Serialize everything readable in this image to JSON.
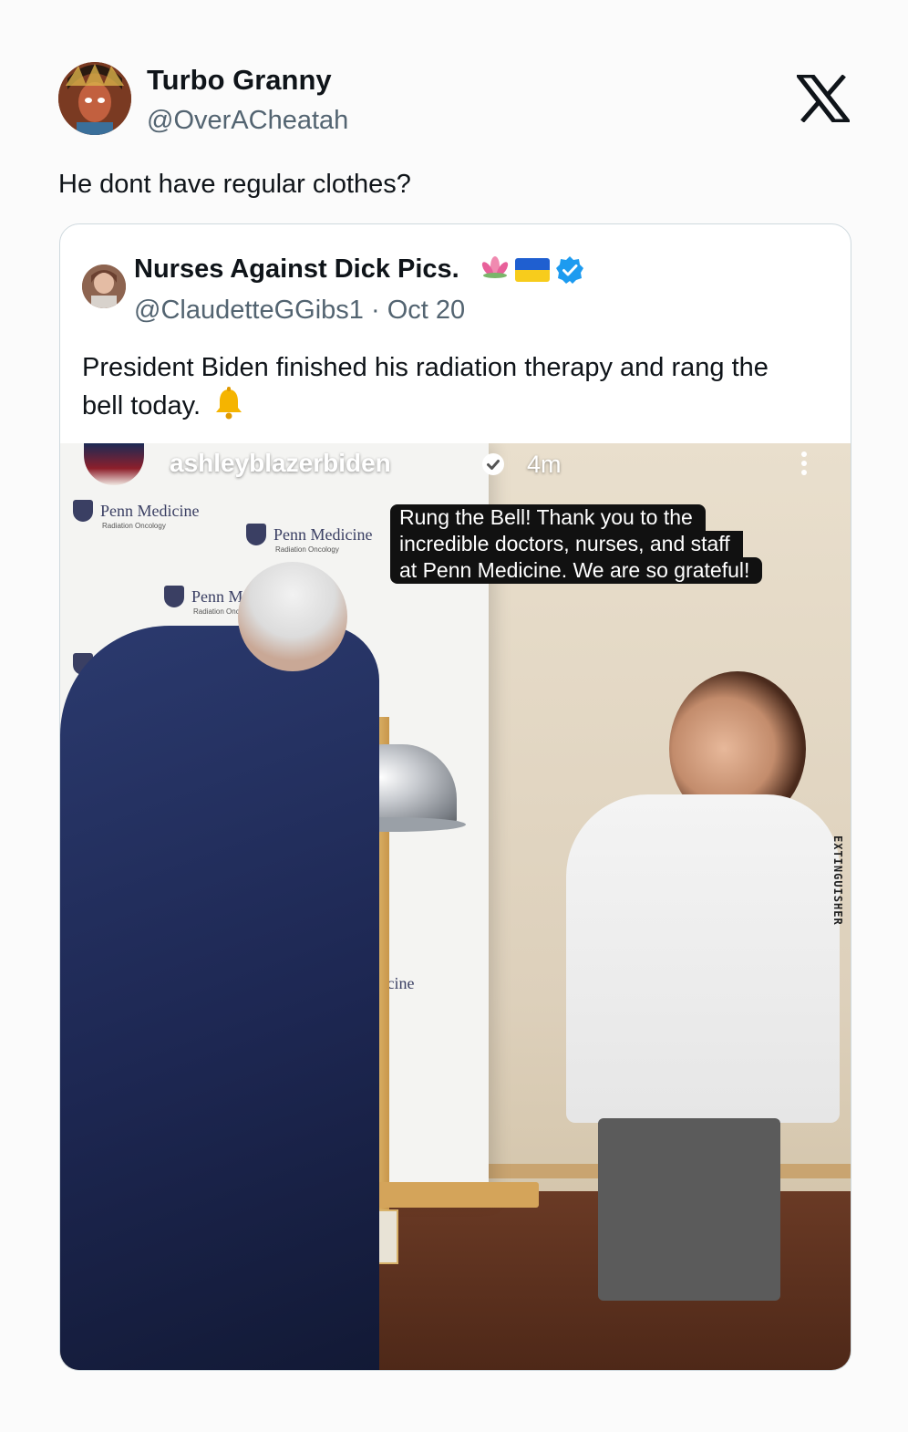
{
  "tweet": {
    "author_name": "Turbo Granny",
    "author_handle": "@OverACheatah",
    "text": "He dont have regular clothes?",
    "platform_icon": "x-logo-icon"
  },
  "quoted": {
    "author_name": "Nurses Against Dick Pics.",
    "author_handle": "@ClaudetteGGibs1",
    "separator": "·",
    "date": "Oct 20",
    "emojis": [
      "lotus-icon",
      "ukraine-flag-icon",
      "verified-badge-icon"
    ],
    "text": "President Biden finished his radiation therapy and rang the bell today.",
    "trailing_emoji": "bell-icon"
  },
  "story": {
    "username": "ashleyblazerbiden",
    "time": "4m",
    "caption_lines": [
      "Rung the Bell! Thank you to the",
      "incredible doctors, nurses, and staff",
      "at Penn Medicine. We are so grateful!"
    ],
    "backdrop_logo": {
      "title": "Penn Medicine",
      "subtitle": "Radiation Oncology"
    },
    "wall_label": "EXTINGUISHER"
  },
  "colors": {
    "text_primary": "#0f1419",
    "text_secondary": "#536471",
    "border": "#cfd9de",
    "verified_blue": "#1d9bf0",
    "background": "#fbfbfb"
  }
}
